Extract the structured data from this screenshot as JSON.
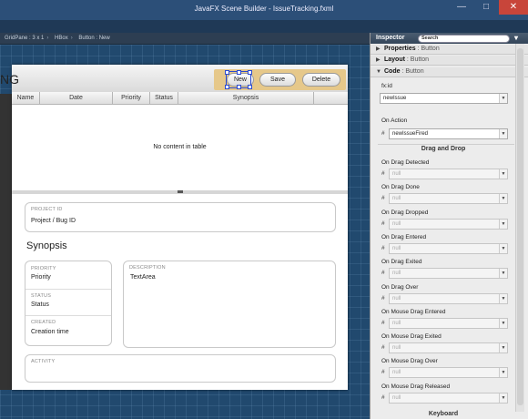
{
  "window": {
    "title": "JavaFX Scene Builder - IssueTracking.fxml",
    "minimize": "—",
    "maximize": "□",
    "close": "✕"
  },
  "breadcrumb": [
    "GridPane : 3 x 1",
    "HBox",
    "Button : New"
  ],
  "app": {
    "title_fragment": "NG",
    "buttons": {
      "new": "New",
      "save": "Save",
      "delete": "Delete"
    },
    "table": {
      "columns": [
        "Name",
        "Date",
        "Priority",
        "Status",
        "Synopsis"
      ],
      "empty_text": "No content in table"
    },
    "form": {
      "project_label": "PROJECT ID",
      "project_value": "Project / Bug ID",
      "synopsis_heading": "Synopsis",
      "priority_label": "PRIORITY",
      "priority_value": "Priority",
      "status_label": "STATUS",
      "status_value": "Status",
      "created_label": "CREATED",
      "created_value": "Creation time",
      "description_label": "DESCRIPTION",
      "description_value": "TextArea",
      "activity_label": "ACTIVITY"
    }
  },
  "inspector": {
    "title": "Inspector",
    "search_placeholder": "Search",
    "sections": {
      "properties": {
        "name": "Properties",
        "sub": ": Button"
      },
      "layout": {
        "name": "Layout",
        "sub": ": Button"
      },
      "code": {
        "name": "Code",
        "sub": ": Button"
      }
    },
    "fxid_label": "fx:id",
    "fxid_value": "newIssue",
    "on_action_label": "On Action",
    "on_action_value": "newIssueFired",
    "drag_drop_title": "Drag and Drop",
    "null_value": "null",
    "events": [
      "On Drag Detected",
      "On Drag Done",
      "On Drag Dropped",
      "On Drag Entered",
      "On Drag Exited",
      "On Drag Over",
      "On Mouse Drag Entered",
      "On Mouse Drag Exited",
      "On Mouse Drag Over",
      "On Mouse Drag Released"
    ],
    "keyboard_title": "Keyboard",
    "hash": "#"
  },
  "colors": {
    "canvas": "#21496e",
    "button_bar": "#e6c88a",
    "selection": "#2b4ad0",
    "close_button": "#c8453a"
  },
  "icons": [
    "search-icon",
    "dropdown-arrow-icon",
    "section-arrow-icon",
    "close-icon"
  ]
}
